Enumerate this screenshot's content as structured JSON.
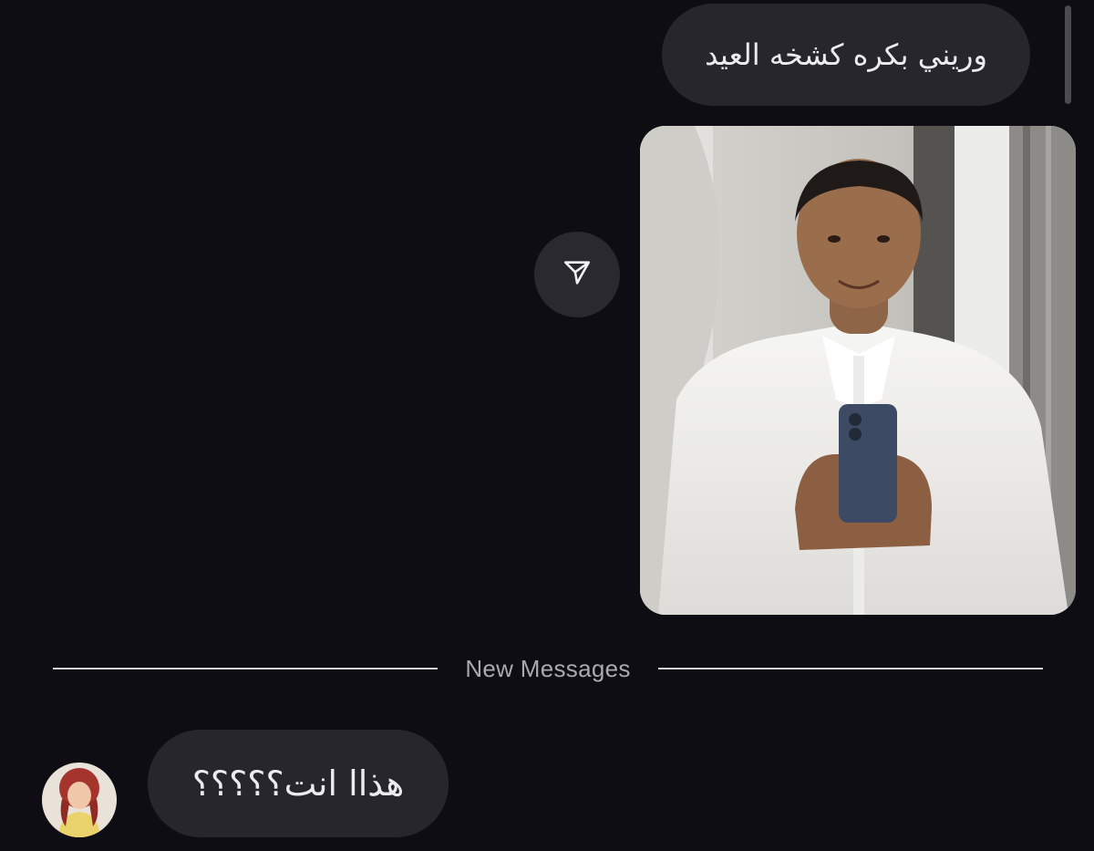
{
  "thread": {
    "outgoing_message": "وريني بكره كشخه العيد",
    "shared_photo": {
      "alt": "Photo"
    },
    "share_icon": "paper-plane-icon",
    "divider_label": "New Messages",
    "incoming_message": "هذاا انت؟؟؟؟؟"
  },
  "sender": {
    "avatar_icon": "profile-avatar"
  },
  "colors": {
    "background": "#0d0d13",
    "bubble": "#26262c",
    "text": "#ececef",
    "divider_line": "#d4d4d8",
    "divider_text": "#a9a9b0"
  }
}
